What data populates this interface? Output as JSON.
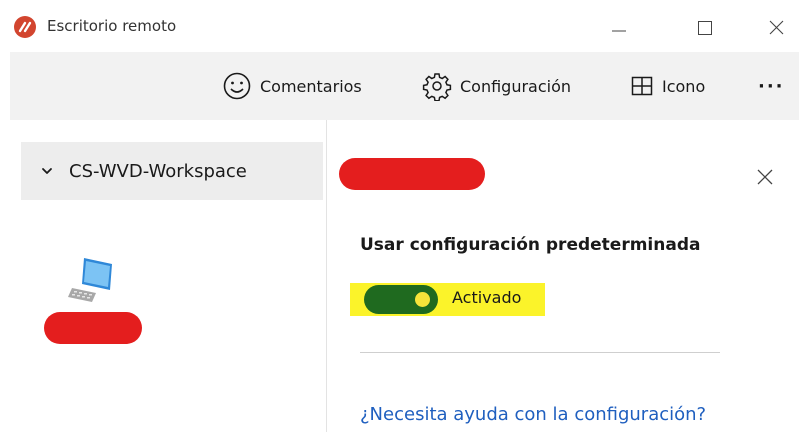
{
  "window": {
    "title": "Escritorio remoto",
    "icons": {
      "app": "remote-desktop-logo-icon",
      "minimize": "minimize-icon",
      "maximize": "maximize-icon",
      "close": "close-icon"
    }
  },
  "toolbar": {
    "feedback_label": "Comentarios",
    "settings_label": "Configuración",
    "tile_label": "Icono",
    "more_label": "···",
    "icons": {
      "feedback": "smiley-icon",
      "settings": "gear-icon",
      "tile": "grid-icon",
      "more": "more-dots-icon"
    }
  },
  "sidebar": {
    "workspace_label": "CS-WVD-Workspace",
    "workspace_expanded": true,
    "desktop_icon": "desktop-computer-icon"
  },
  "panel": {
    "setting_title": "Usar configuración predeterminada",
    "toggle_state": "Activado",
    "toggle_on": true,
    "help_link": "¿Necesita ayuda con la configuración?"
  },
  "colors": {
    "accent_link": "#1f5fbf",
    "toggle_on": "#1f6a1f",
    "highlight": "#fbf32a",
    "redaction": "#e41e1e",
    "app_logo": "#d2452f"
  }
}
